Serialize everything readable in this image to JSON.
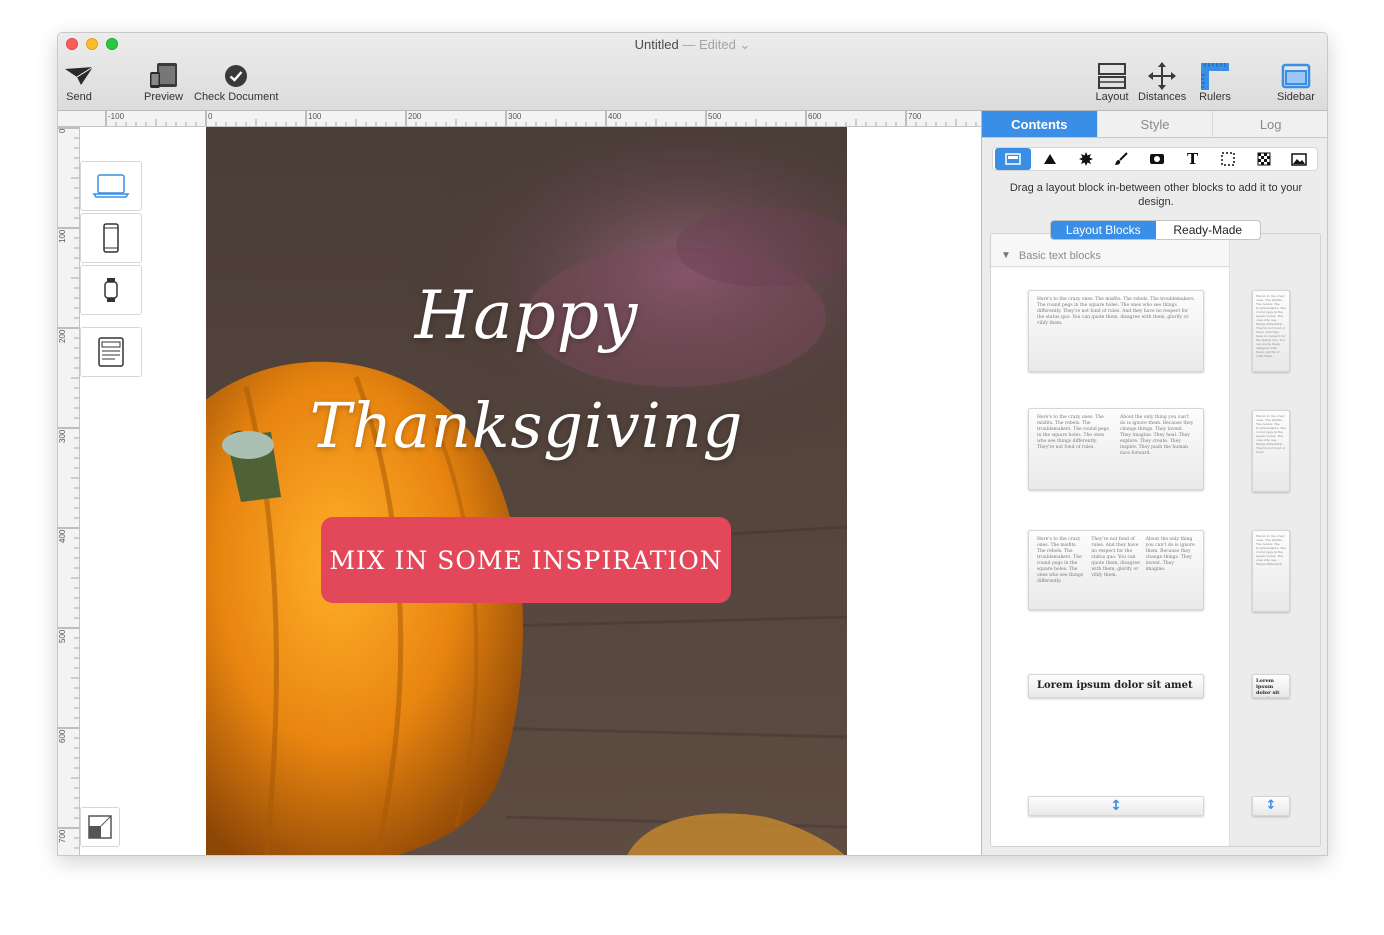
{
  "window": {
    "title": "Untitled",
    "status": "Edited",
    "chevron": "⌄"
  },
  "toolbar": {
    "left": [
      {
        "label": "Send"
      },
      {
        "label": "Preview"
      },
      {
        "label": "Check Document"
      }
    ],
    "right": [
      {
        "label": "Layout"
      },
      {
        "label": "Distances"
      },
      {
        "label": "Rulers"
      },
      {
        "label": "Sidebar"
      }
    ]
  },
  "ruler": {
    "h_labels": [
      "-100",
      "0",
      "100",
      "200",
      "300",
      "400",
      "500",
      "600",
      "700"
    ],
    "v_labels": [
      "0",
      "100",
      "200",
      "300",
      "400",
      "500",
      "600",
      "700"
    ]
  },
  "devices": [
    "desktop-icon",
    "phone-icon",
    "watch-icon",
    "layout-view-icon"
  ],
  "design": {
    "headline_line1": "Happy",
    "headline_line2": "Thanksgiving",
    "cta_label": "MIX IN SOME INSPIRATION",
    "cta_color": "#e2485a"
  },
  "sidebar": {
    "tabs": [
      "Contents",
      "Style",
      "Log"
    ],
    "active_tab": "Contents",
    "hint": "Drag a layout block in-between other blocks to add it to your design.",
    "segments": [
      "Layout Blocks",
      "Ready-Made"
    ],
    "section_title": "Basic text blocks",
    "block_text": {
      "one_col": "Here's to the crazy ones. The misfits. The rebels. The troublemakers. The round pegs in the square holes. The ones who see things differently. They're not fond of rules. And they have no respect for the status quo. You can quote them, disagree with them, glorify or vilify them.",
      "two_col_a": "Here's to the crazy ones. The misfits. The rebels. The troublemakers. The round pegs in the square holes. The ones who see things differently. They're not fond of rules.",
      "two_col_b": "About the only thing you can't do is ignore them. Because they change things. They invent. They imagine. They heal. They explore. They create. They inspire. They push the human race forward.",
      "three_col_a": "Here's to the crazy ones. The misfits. The rebels. The troublemakers. The round pegs in the square holes. The ones who see things differently.",
      "three_col_b": "They're not fond of rules. And they have no respect for the status quo. You can quote them, disagree with them, glorify or vilify them.",
      "three_col_c": "About the only thing you can't do is ignore them. Because they change things. They invent. They imagine.",
      "heading": "Lorem ipsum dolor sit amet",
      "mini_heading": "Lorem ipsum dolor sit amet",
      "spacer_glyph": "↕"
    }
  },
  "colors": {
    "accent": "#3a8ee6",
    "cta": "#e2485a"
  }
}
